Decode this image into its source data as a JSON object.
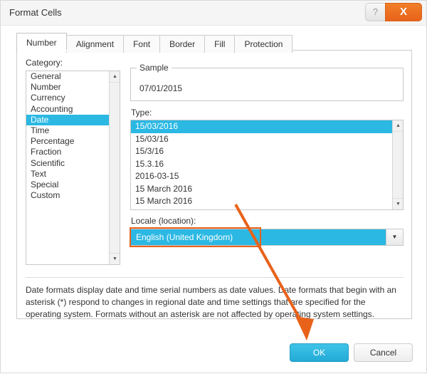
{
  "window": {
    "title": "Format Cells",
    "help_label": "?",
    "close_label": "X"
  },
  "tabs": [
    {
      "label": "Number",
      "active": true
    },
    {
      "label": "Alignment",
      "active": false
    },
    {
      "label": "Font",
      "active": false
    },
    {
      "label": "Border",
      "active": false
    },
    {
      "label": "Fill",
      "active": false
    },
    {
      "label": "Protection",
      "active": false
    }
  ],
  "category": {
    "label": "Category:",
    "items": [
      "General",
      "Number",
      "Currency",
      "Accounting",
      "Date",
      "Time",
      "Percentage",
      "Fraction",
      "Scientific",
      "Text",
      "Special",
      "Custom"
    ],
    "selected": "Date",
    "scroll_up_icon": "▲",
    "scroll_down_icon": "▼"
  },
  "sample": {
    "legend": "Sample",
    "value": "07/01/2015"
  },
  "type": {
    "label": "Type:",
    "items": [
      "15/03/2016",
      "15/03/16",
      "15/3/16",
      "15.3.16",
      "2016-03-15",
      "15 March 2016",
      "15 March 2016"
    ],
    "selected": "15/03/2016",
    "scroll_up_icon": "▲",
    "scroll_down_icon": "▼"
  },
  "locale": {
    "label": "Locale (location):",
    "value": "English (United Kingdom)",
    "dropdown_icon": "▼"
  },
  "description": "Date formats display date and time serial numbers as date values. Date formats that begin with an asterisk (*) respond to changes in regional date and time settings that are specified for the operating system. Formats without an asterisk are not affected by operating system settings.",
  "footer": {
    "ok_label": "OK",
    "cancel_label": "Cancel"
  },
  "annotation": {
    "accent_color": "#e8621a",
    "description": "orange arrow from locale field to OK button"
  }
}
